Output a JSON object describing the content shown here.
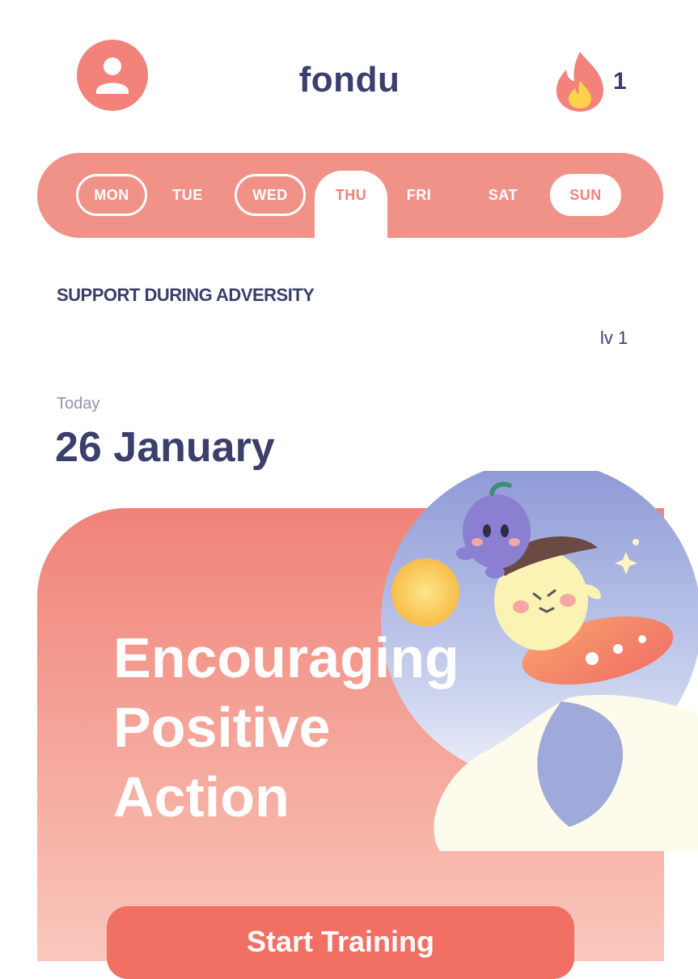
{
  "header": {
    "brand": "fondu",
    "streak_count": "1",
    "icons": {
      "profile": "user-icon",
      "streak": "flame-icon"
    }
  },
  "week": {
    "days": [
      {
        "label": "MON",
        "state": "completed"
      },
      {
        "label": "TUE",
        "state": "default"
      },
      {
        "label": "WED",
        "state": "completed"
      },
      {
        "label": "THU",
        "state": "today"
      },
      {
        "label": "FRI",
        "state": "default"
      },
      {
        "label": "SAT",
        "state": "default"
      },
      {
        "label": "SUN",
        "state": "target"
      }
    ]
  },
  "section": {
    "title": "SUPPORT DURING ADVERSITY",
    "level": "lv 1"
  },
  "today": {
    "label": "Today",
    "date": "26 January"
  },
  "card": {
    "title_lines": [
      "Encouraging",
      "Positive",
      "Action"
    ],
    "button_label": "Start Training"
  },
  "colors": {
    "accent": "#f2827a",
    "navy": "#3a3f6b",
    "card_top": "#f08379",
    "card_bottom": "#f9c8bd"
  }
}
